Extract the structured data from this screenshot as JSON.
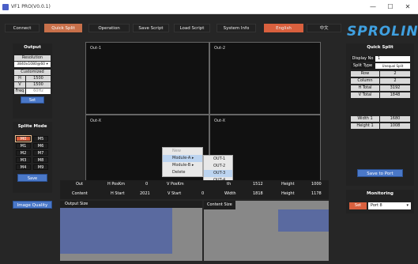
{
  "window": {
    "title": "VF1 PRO(V0.0.1)",
    "min": "—",
    "max": "☐",
    "close": "✕"
  },
  "menu": {
    "connect": "Connect",
    "quick_split": "Quick Split",
    "operation": "Operation",
    "save_script": "Save Script",
    "load_script": "Load Script",
    "system_info": "System Info",
    "english": "English",
    "chinese": "中文",
    "logo": "SPROLINK"
  },
  "output_panel": {
    "title": "Output",
    "resolution_label": "Resolution",
    "resolution_value": "3840x1080@60 ▾",
    "customized_label": "Customized",
    "h_label": "H",
    "h_value": "1500",
    "v_label": "V",
    "v_value": "1500",
    "freq_label": "Freq",
    "freq_value": "60Hz",
    "set_label": "Set"
  },
  "split_mode": {
    "title": "Splite Mode",
    "buttons": [
      "M0",
      "M5",
      "M1",
      "M6",
      "M2",
      "M7",
      "M3",
      "M8",
      "M4",
      "M9"
    ],
    "save_label": "Save",
    "image_quality": "Image Quality"
  },
  "canvas": {
    "cells": [
      "Out-1",
      "Out-2",
      "Out-X",
      "Out-X"
    ]
  },
  "context_menu": {
    "items": [
      "New",
      "Module-A",
      "Module-B",
      "Delete"
    ],
    "submenu": [
      "OUT-1",
      "OUT-2",
      "OUT-3",
      "OUT-4"
    ]
  },
  "info_bar": {
    "out_label": "Out",
    "hpos_label": "H PosKm",
    "hpos_value": "0",
    "vpos_label": "V PosKm",
    "width_label": "th",
    "width_value": "1512",
    "height_label": "Height",
    "height_value": "1000",
    "content_label": "Content",
    "hstart_label": "H Start",
    "hstart_value": "2021",
    "vstart_label": "V Start",
    "vstart_value": "0",
    "width2_label": "Width",
    "width2_value": "1818",
    "height2_label": "Height",
    "height2_value": "1178"
  },
  "output_size": {
    "title": "Output Size"
  },
  "content_size": {
    "title": "Content Size"
  },
  "quick_split": {
    "title": "Quick Split",
    "display_no_label": "Display No",
    "display_no_value": "1",
    "split_type_label": "Split Type",
    "split_type_value": "Unequal Split",
    "row_label": "Row",
    "row_value": "2",
    "column_label": "Column",
    "column_value": "2",
    "htotal_label": "H Total",
    "htotal_value": "3192",
    "vtotal_label": "V Total",
    "vtotal_value": "1848",
    "width1_label": "Width 1",
    "width1_value": "1680",
    "height1_label": "Height 1",
    "height1_value": "1008",
    "save_to_port": "Save to Port"
  },
  "monitoring": {
    "title": "Monitoring",
    "set_label": "Set",
    "port_value": "Port 8"
  },
  "colors": {
    "accent": "#d9603e",
    "blue": "#4a78c8",
    "preview": "#5a6aa0",
    "logo": "#3fa0e0"
  }
}
